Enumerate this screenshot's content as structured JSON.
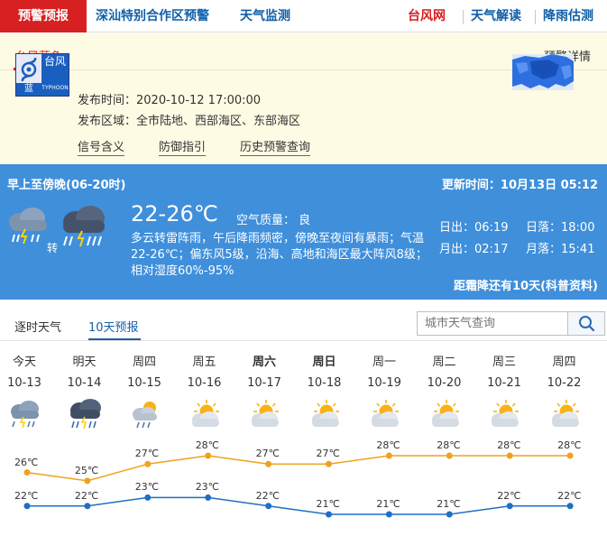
{
  "nav": {
    "active_tab": "预警预报",
    "items": [
      "深汕特别合作区预警",
      "天气监测"
    ],
    "right_items": [
      "台风网",
      "天气解读",
      "降雨估测"
    ],
    "colors": {
      "active_bg": "#d62021",
      "link_blue": "#0f5ea8",
      "link_red": "#d62021"
    }
  },
  "warning": {
    "tab_label": "台风蓝色",
    "detail_link": "预警详情",
    "badge": {
      "cn": "台风",
      "color_label": "蓝",
      "en": "TYPHOON",
      "icon": "typhoon-spiral-icon"
    },
    "publish_time": "发布时间：2020-10-12 17:00:00",
    "publish_area": "发布区域：全市陆地、西部海区、东部海区",
    "links": [
      "信号含义",
      "防御指引",
      "历史预警查询"
    ]
  },
  "weather": {
    "period": "早上至傍晚(06-20时)",
    "update": "更新时间：10月13日 05:12",
    "zhuan": "转",
    "temp_range": "22-26℃",
    "aqi": "空气质量： 良",
    "description": "多云转雷阵雨，午后降雨频密，傍晚至夜间有暴雨；气温22-26℃；偏东风5级，沿海、高地和海区最大阵风8级；相对湿度60%-95%",
    "sunrise": "日出：06:19",
    "sunset": "日落：18:00",
    "moonrise": "月出：02:17",
    "moonset": "月落：15:41",
    "countdown": "距霜降还有10天(科普资料)",
    "colors": {
      "panel_bg": "#3f8fdb"
    }
  },
  "forecast": {
    "tabs": [
      "逐时天气",
      "10天预报"
    ],
    "active_tab": "10天预报",
    "search_placeholder": "城市天气查询",
    "days": [
      {
        "name": "今天",
        "date": "10-13",
        "icon": "thunder-rain-icon",
        "bold": false
      },
      {
        "name": "明天",
        "date": "10-14",
        "icon": "heavy-thunder-rain-icon",
        "bold": false
      },
      {
        "name": "周四",
        "date": "10-15",
        "icon": "cloudy-shower-icon",
        "bold": false
      },
      {
        "name": "周五",
        "date": "10-16",
        "icon": "partly-cloudy-icon",
        "bold": false
      },
      {
        "name": "周六",
        "date": "10-17",
        "icon": "partly-cloudy-icon",
        "bold": true
      },
      {
        "name": "周日",
        "date": "10-18",
        "icon": "partly-cloudy-icon",
        "bold": true
      },
      {
        "name": "周一",
        "date": "10-19",
        "icon": "partly-cloudy-icon",
        "bold": false
      },
      {
        "name": "周二",
        "date": "10-20",
        "icon": "partly-cloudy-icon",
        "bold": false
      },
      {
        "name": "周三",
        "date": "10-21",
        "icon": "partly-cloudy-icon",
        "bold": false
      },
      {
        "name": "周四",
        "date": "10-22",
        "icon": "partly-cloudy-icon",
        "bold": false
      }
    ]
  },
  "chart_data": {
    "type": "line",
    "categories": [
      "10-13",
      "10-14",
      "10-15",
      "10-16",
      "10-17",
      "10-18",
      "10-19",
      "10-20",
      "10-21",
      "10-22"
    ],
    "series": [
      {
        "values": [
          26,
          25,
          27,
          28,
          27,
          27,
          28,
          28,
          28,
          28
        ],
        "labels": [
          "26℃",
          "25℃",
          "27℃",
          "28℃",
          "27℃",
          "27℃",
          "28℃",
          "28℃",
          "28℃",
          "28℃"
        ],
        "color": "#f0a21e"
      },
      {
        "values": [
          22,
          22,
          23,
          23,
          22,
          21,
          21,
          21,
          22,
          22
        ],
        "labels": [
          "22℃",
          "22℃",
          "23℃",
          "23℃",
          "22℃",
          "21℃",
          "21℃",
          "21℃",
          "22℃",
          "22℃"
        ],
        "color": "#1f6fc4"
      }
    ]
  }
}
